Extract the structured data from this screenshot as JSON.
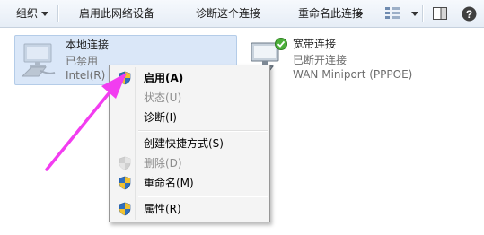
{
  "toolbar": {
    "organize": "组织",
    "enable_device": "启用此网络设备",
    "diagnose": "诊断这个连接",
    "rename": "重命名此连接",
    "more": "»"
  },
  "connections": [
    {
      "name": "本地连接",
      "status": "已禁用",
      "device": "Intel(R) P"
    },
    {
      "name": "宽带连接",
      "status": "已断开连接",
      "device": "WAN Miniport (PPPOE)"
    }
  ],
  "context_menu": {
    "items": [
      {
        "label": "启用(A)"
      },
      {
        "label": "状态(U)"
      },
      {
        "label": "诊断(I)"
      },
      {
        "label": "创建快捷方式(S)"
      },
      {
        "label": "删除(D)"
      },
      {
        "label": "重命名(M)"
      },
      {
        "label": "属性(R)"
      }
    ]
  },
  "colors": {
    "arrow": "#f23df0",
    "selection": "#dae7f8",
    "shield_blue": "#2f6fbf",
    "shield_yellow": "#f2c230"
  }
}
